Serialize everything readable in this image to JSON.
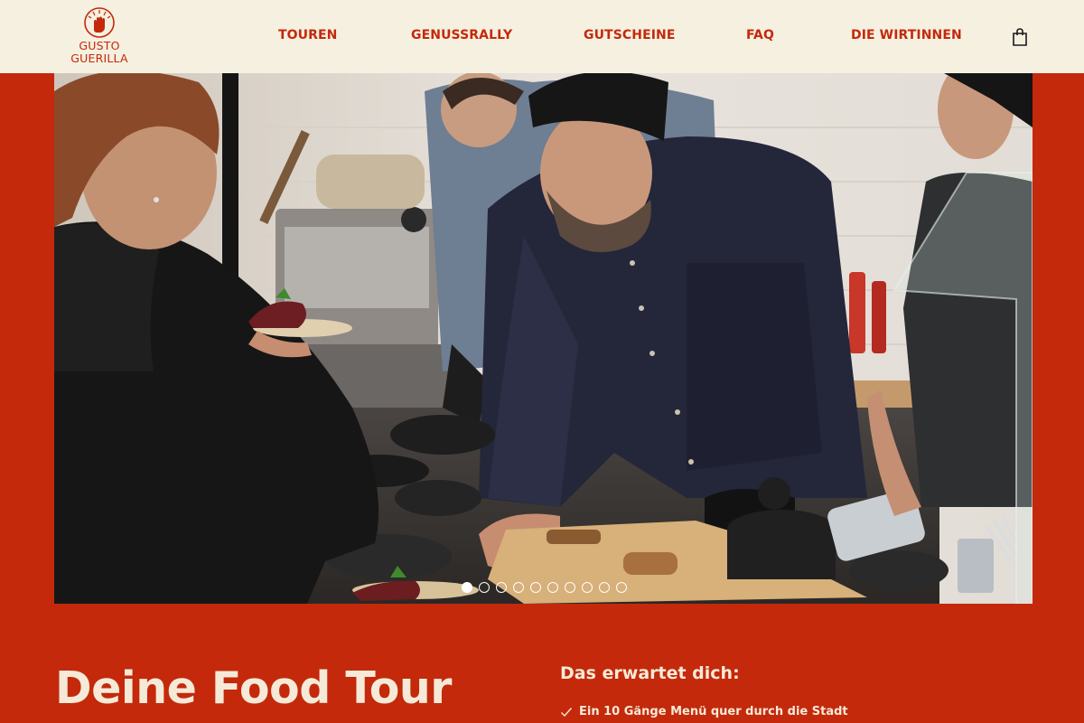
{
  "brand": {
    "logo_line1": "GUSTO",
    "logo_line2": "GUERILLA",
    "color": "#c4290b"
  },
  "nav": {
    "items": [
      {
        "label": "TOUREN"
      },
      {
        "label": "GENUSSRALLY"
      },
      {
        "label": "GUTSCHEINE"
      },
      {
        "label": "FAQ"
      },
      {
        "label": "DIE WIRTINNEN"
      }
    ],
    "cart_icon": "shopping-bag-icon"
  },
  "hero": {
    "slide_count": 10,
    "active_slide": 1
  },
  "content": {
    "title": "Deine Food Tour",
    "expect_heading": "Das erwartet dich:",
    "expect_items": [
      "Ein 10 Gänge Menü quer durch die Stadt"
    ]
  },
  "colors": {
    "background": "#c4290b",
    "header_bg": "#f5f0e0",
    "text_light": "#f5ead7"
  }
}
